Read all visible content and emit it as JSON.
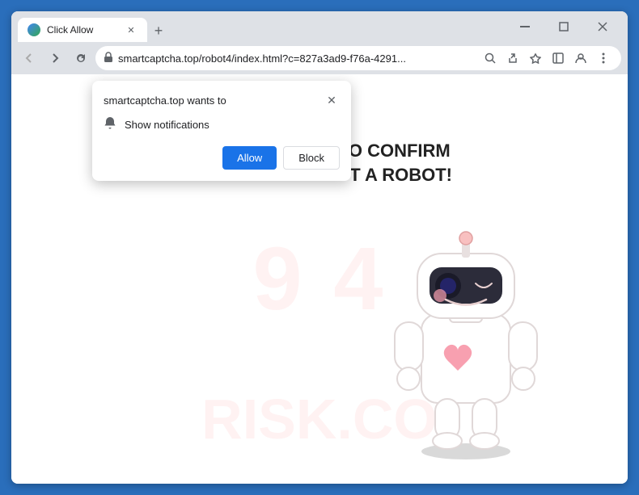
{
  "window": {
    "title": "Click Allow",
    "tab_title": "Click Allow",
    "close_label": "✕",
    "minimize_label": "─",
    "maximize_label": "□"
  },
  "address_bar": {
    "url": "smartcaptcha.top/robot4/index.html?c=827a3ad9-f76a-4291...",
    "lock_symbol": "🔒"
  },
  "nav": {
    "back": "←",
    "forward": "→",
    "reload": "↻"
  },
  "popup": {
    "site": "smartcaptcha.top wants to",
    "notification_label": "Show notifications",
    "allow_label": "Allow",
    "block_label": "Block",
    "close_label": "✕"
  },
  "page": {
    "main_text": "CLICK «ALLOW» TO CONFIRM THAT YOU ARE NOT A ROBOT!",
    "watermark_top": "9 4",
    "watermark_bottom": "RISK.CO"
  },
  "icons": {
    "bell": "🔔",
    "search": "🔍",
    "share": "↗",
    "star": "☆",
    "sidebar": "▭",
    "profile": "👤",
    "menu": "⋮",
    "new_tab": "+"
  }
}
